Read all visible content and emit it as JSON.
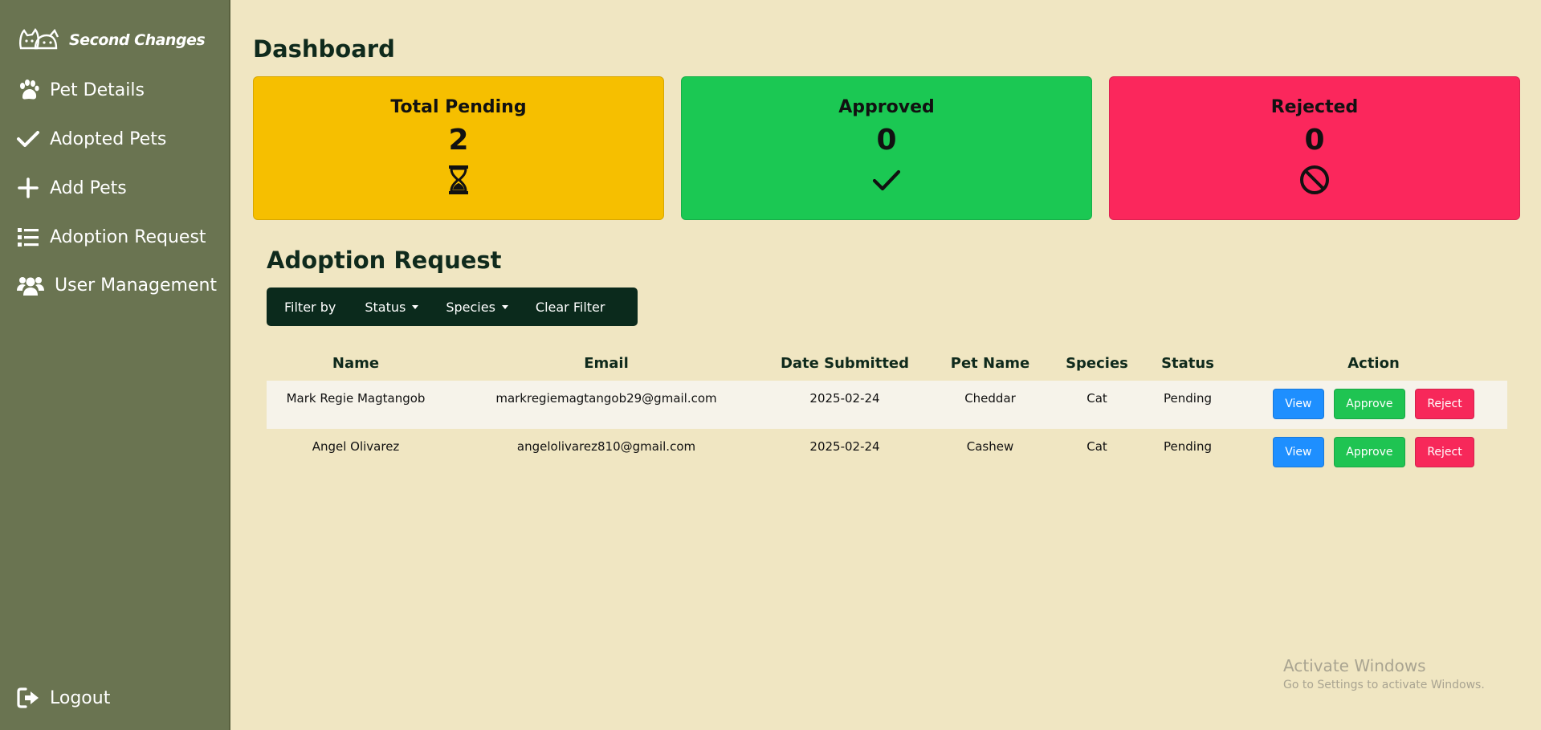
{
  "brand": {
    "name": "Second Changes"
  },
  "sidebar": {
    "items": [
      {
        "label": "Pet Details",
        "icon": "paw-icon"
      },
      {
        "label": "Adopted Pets",
        "icon": "check-icon"
      },
      {
        "label": "Add Pets",
        "icon": "plus-icon"
      },
      {
        "label": "Adoption Request",
        "icon": "list-icon"
      },
      {
        "label": "User Management",
        "icon": "users-icon"
      }
    ],
    "logout": {
      "label": "Logout",
      "icon": "logout-icon"
    }
  },
  "dashboard": {
    "title": "Dashboard",
    "cards": [
      {
        "label": "Total Pending",
        "value": "2",
        "color": "#F6BF00",
        "icon": "hourglass-icon"
      },
      {
        "label": "Approved",
        "value": "0",
        "color": "#1BC853",
        "icon": "check-icon"
      },
      {
        "label": "Rejected",
        "value": "0",
        "color": "#FB275C",
        "icon": "ban-icon"
      }
    ]
  },
  "requests": {
    "title": "Adoption Request",
    "filters": {
      "label": "Filter by",
      "status": "Status",
      "species": "Species",
      "clear": "Clear Filter"
    },
    "columns": [
      "Name",
      "Email",
      "Date Submitted",
      "Pet Name",
      "Species",
      "Status",
      "Action"
    ],
    "rows": [
      {
        "name": "Mark Regie Magtangob",
        "email": "markregiemagtangob29@gmail.com",
        "date": "2025-02-24",
        "pet": "Cheddar",
        "species": "Cat",
        "status": "Pending"
      },
      {
        "name": "Angel Olivarez",
        "email": "angelolivarez810@gmail.com",
        "date": "2025-02-24",
        "pet": "Cashew",
        "species": "Cat",
        "status": "Pending"
      }
    ],
    "actions": {
      "view": "View",
      "approve": "Approve",
      "reject": "Reject"
    }
  },
  "watermark": {
    "title": "Activate Windows",
    "subtitle": "Go to Settings to activate Windows."
  },
  "colors": {
    "sidebar": "#6A7451",
    "background": "#F0E6C2",
    "filter_bar": "#0B2A1C",
    "view": "#1E8FFF",
    "approve": "#1FC452",
    "reject": "#F7285A"
  }
}
